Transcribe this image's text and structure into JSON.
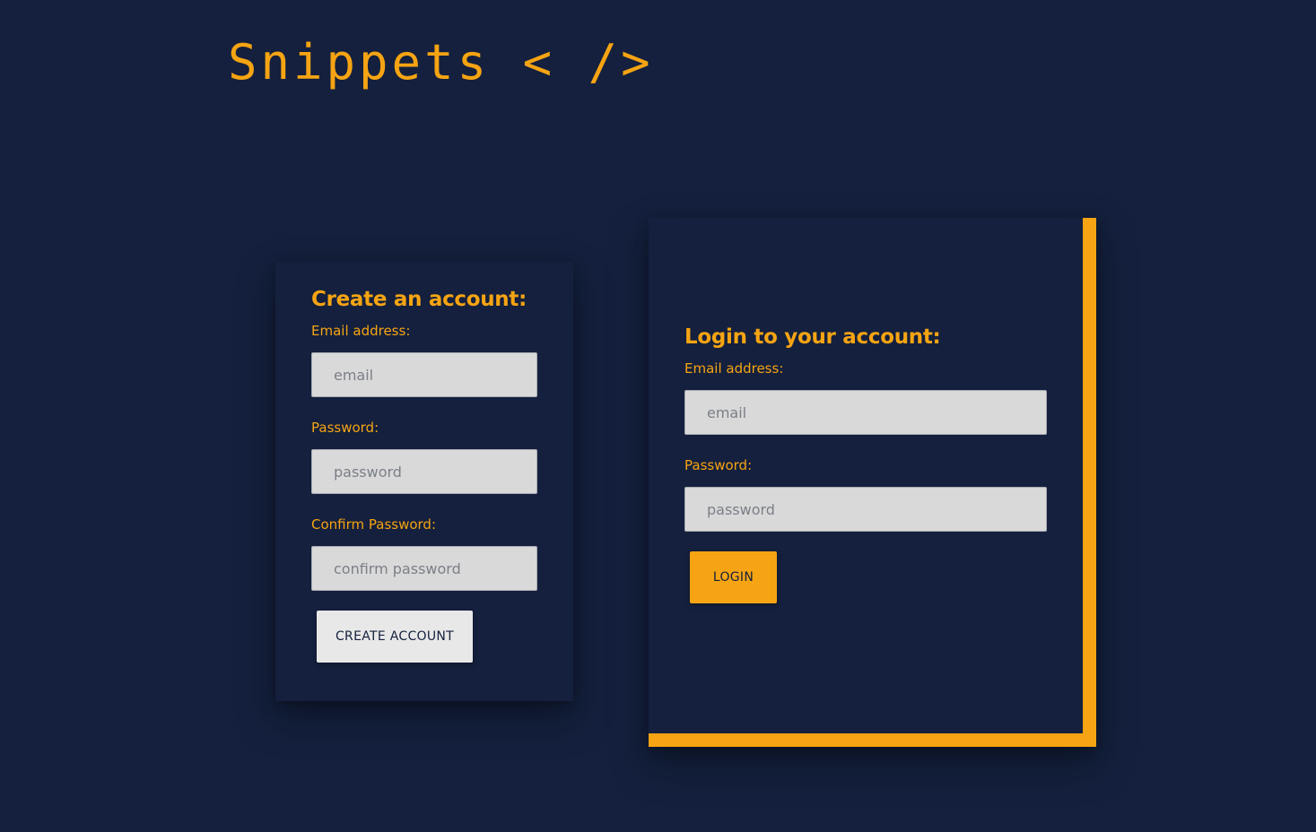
{
  "brand": {
    "logo_text": "Snippets < />"
  },
  "colors": {
    "background": "#14203d",
    "accent": "#f6a413",
    "input_bg": "#d9d9d9",
    "secondary_button_bg": "#e8e8e8"
  },
  "signup": {
    "heading": "Create an account:",
    "email_label": "Email address:",
    "email_placeholder": "email",
    "password_label": "Password:",
    "password_placeholder": "password",
    "confirm_label": "Confirm Password:",
    "confirm_placeholder": "confirm password",
    "submit_label": "CREATE ACCOUNT"
  },
  "login": {
    "heading": "Login to your account:",
    "email_label": "Email address:",
    "email_placeholder": "email",
    "password_label": "Password:",
    "password_placeholder": "password",
    "submit_label": "LOGIN"
  }
}
